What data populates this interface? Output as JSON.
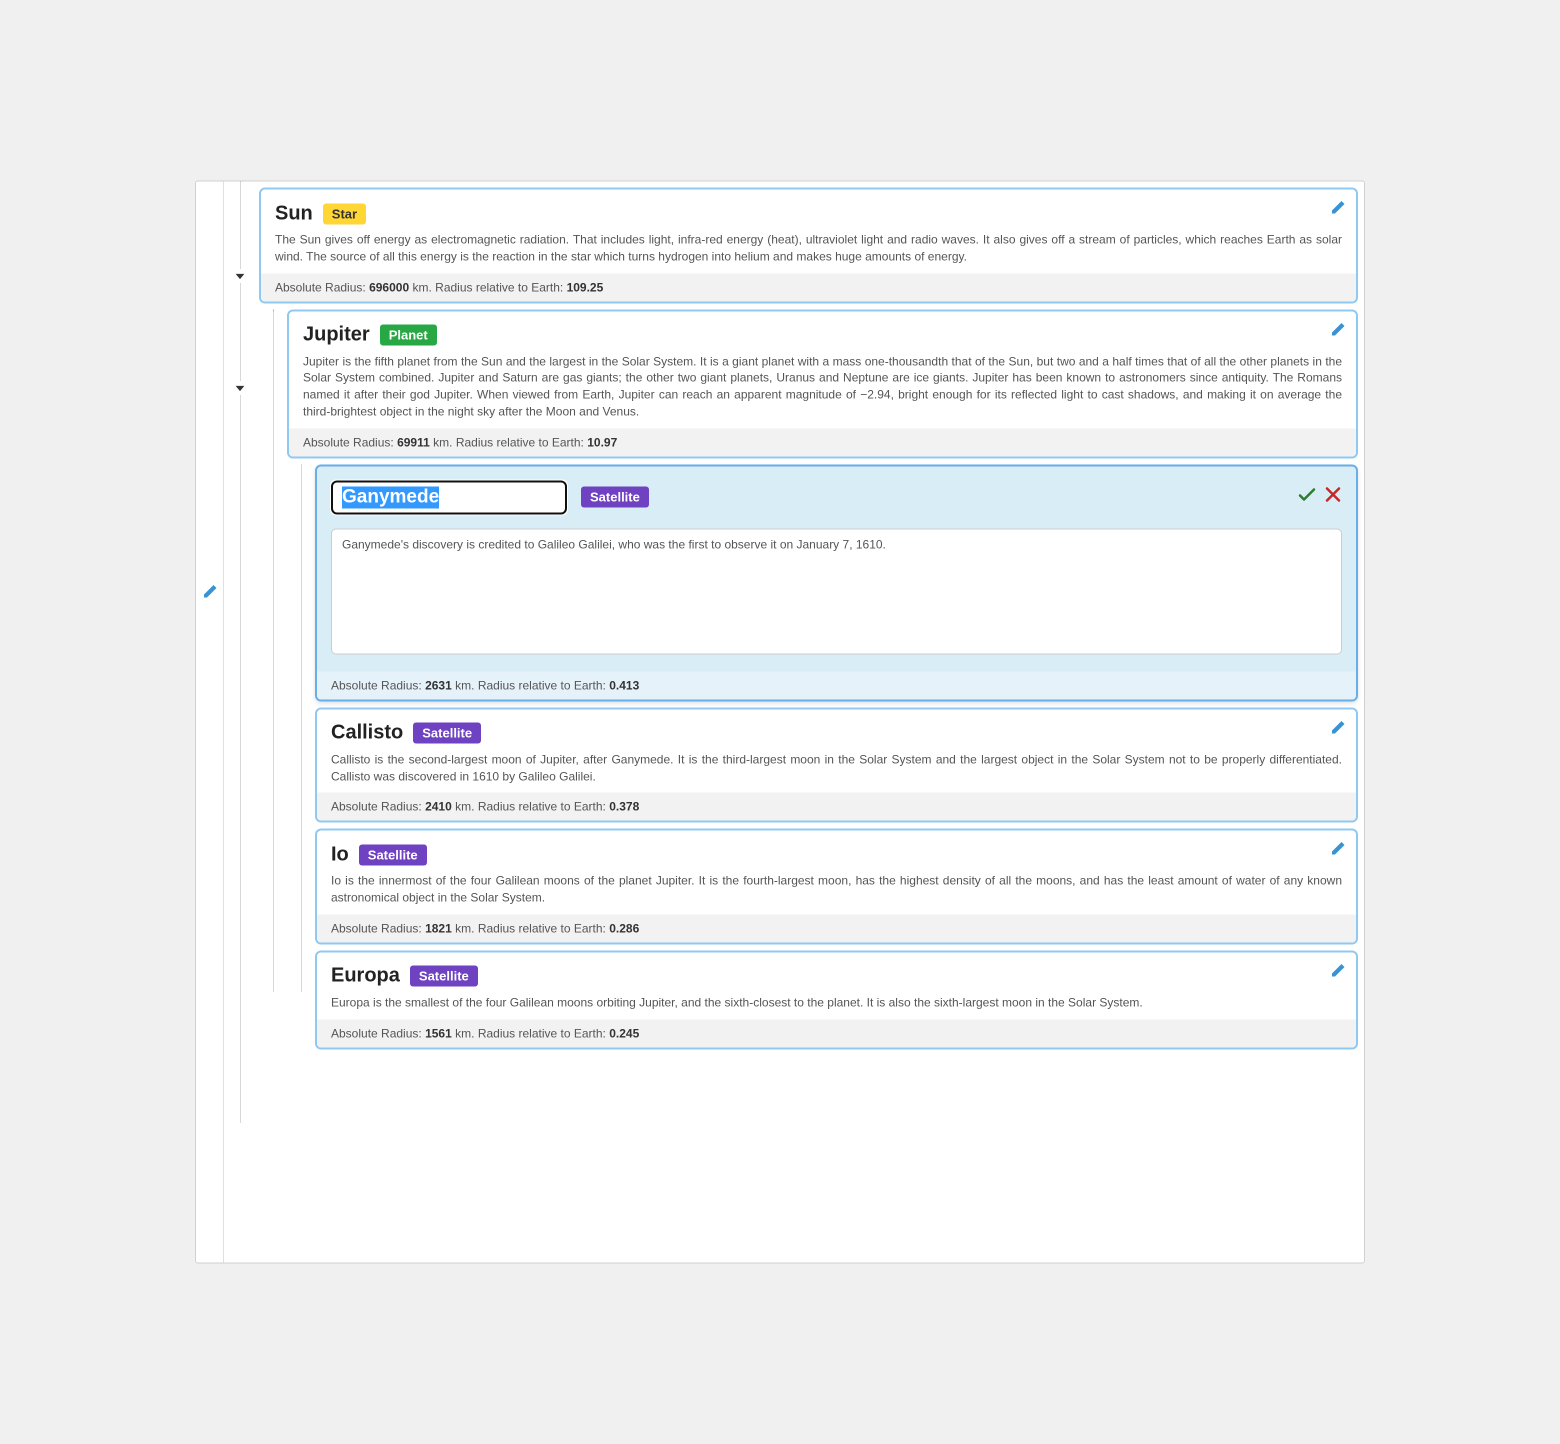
{
  "labels": {
    "abs_radius": "Absolute Radius:",
    "rel_radius": "Radius relative to Earth:",
    "km": "km."
  },
  "badges": {
    "star": "Star",
    "planet": "Planet",
    "satellite": "Satellite"
  },
  "nodes": {
    "sun": {
      "name": "Sun",
      "desc": "The Sun gives off energy as electromagnetic radiation. That includes light, infra-red energy (heat), ultraviolet light and radio waves. It also gives off a stream of particles, which reaches Earth as solar wind. The source of all this energy is the reaction in the star which turns hydrogen into helium and makes huge amounts of energy.",
      "abs_radius": "696000",
      "rel_radius": "109.25"
    },
    "jupiter": {
      "name": "Jupiter",
      "desc": "Jupiter is the fifth planet from the Sun and the largest in the Solar System. It is a giant planet with a mass one-thousandth that of the Sun, but two and a half times that of all the other planets in the Solar System combined. Jupiter and Saturn are gas giants; the other two giant planets, Uranus and Neptune are ice giants. Jupiter has been known to astronomers since antiquity. The Romans named it after their god Jupiter. When viewed from Earth, Jupiter can reach an apparent magnitude of −2.94, bright enough for its reflected light to cast shadows, and making it on average the third-brightest object in the night sky after the Moon and Venus.",
      "abs_radius": "69911",
      "rel_radius": "10.97"
    },
    "ganymede": {
      "name": "Ganymede",
      "desc": "Ganymede's discovery is credited to Galileo Galilei, who was the first to observe it on January 7, 1610.",
      "abs_radius": "2631",
      "rel_radius": "0.413"
    },
    "callisto": {
      "name": "Callisto",
      "desc": "Callisto is the second-largest moon of Jupiter, after Ganymede. It is the third-largest moon in the Solar System and the largest object in the Solar System not to be properly differentiated. Callisto was discovered in 1610 by Galileo Galilei.",
      "abs_radius": "2410",
      "rel_radius": "0.378"
    },
    "io": {
      "name": "Io",
      "desc": "Io is the innermost of the four Galilean moons of the planet Jupiter. It is the fourth-largest moon, has the highest density of all the moons, and has the least amount of water of any known astronomical object in the Solar System.",
      "abs_radius": "1821",
      "rel_radius": "0.286"
    },
    "europa": {
      "name": "Europa",
      "desc": "Europa is the smallest of the four Galilean moons orbiting Jupiter, and the sixth-closest to the planet. It is also the sixth-largest moon in the Solar System.",
      "abs_radius": "1561",
      "rel_radius": "0.245"
    }
  }
}
